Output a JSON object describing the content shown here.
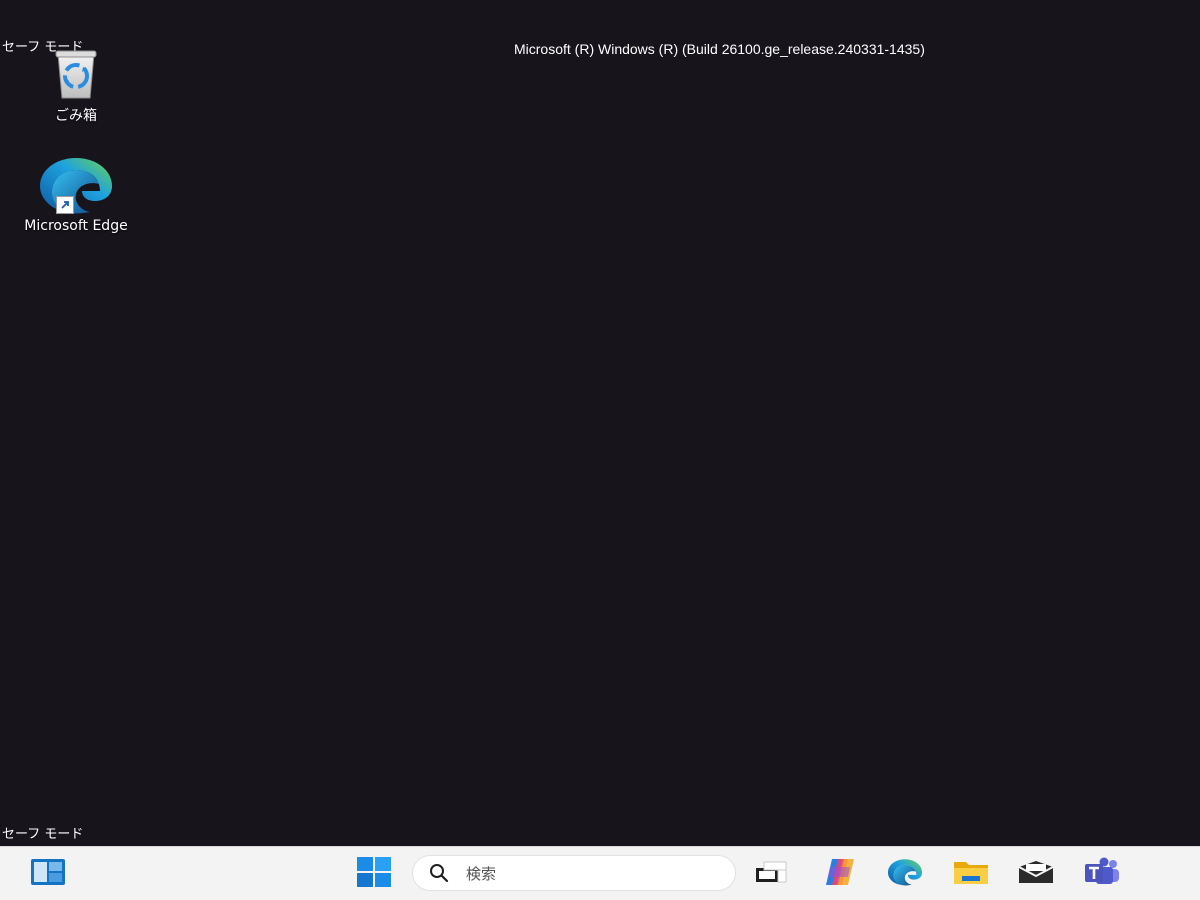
{
  "desktop": {
    "safe_mode_top": "セーフ モード",
    "safe_mode_bottom": "セーフ モード",
    "build_string": "Microsoft (R) Windows (R) (Build 26100.ge_release.240331-1435)",
    "background_color": "#18141c",
    "icons": [
      {
        "label": "ごみ箱",
        "icon": "recycle-bin-icon"
      },
      {
        "label": "Microsoft Edge",
        "icon": "edge-icon"
      }
    ]
  },
  "taskbar": {
    "background_color": "#f3f3f3",
    "search_placeholder": "検索",
    "items": [
      {
        "name": "widgets",
        "icon": "widgets-icon"
      },
      {
        "name": "start",
        "icon": "windows-start-icon"
      },
      {
        "name": "task-view",
        "icon": "task-view-icon"
      },
      {
        "name": "copilot",
        "icon": "copilot-icon"
      },
      {
        "name": "edge",
        "icon": "edge-icon"
      },
      {
        "name": "file-explorer",
        "icon": "folder-icon"
      },
      {
        "name": "mail",
        "icon": "mail-icon"
      },
      {
        "name": "teams",
        "icon": "teams-icon"
      }
    ]
  }
}
